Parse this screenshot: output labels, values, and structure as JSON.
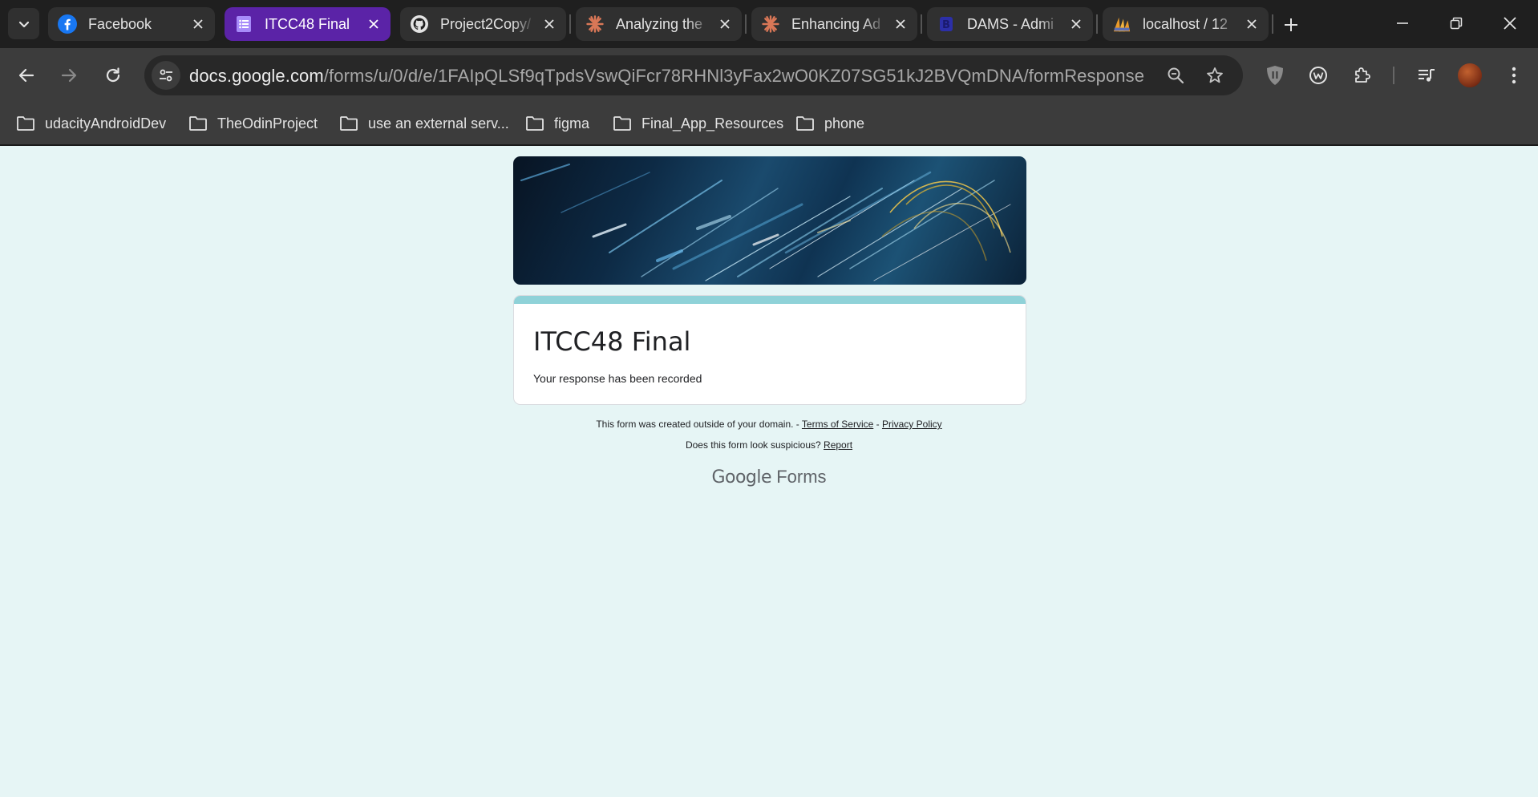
{
  "tabs": [
    {
      "title": "Facebook",
      "icon": "facebook-icon",
      "active": false
    },
    {
      "title": "ITCC48 Final",
      "icon": "google-forms-icon",
      "active": true
    },
    {
      "title": "Project2Copy/",
      "icon": "github-icon",
      "active": false
    },
    {
      "title": "Analyzing the",
      "icon": "claude-icon",
      "active": false
    },
    {
      "title": "Enhancing Ad",
      "icon": "claude-icon",
      "active": false
    },
    {
      "title": "DAMS - Admi",
      "icon": "bootstrap-icon",
      "active": false
    },
    {
      "title": "localhost / 12",
      "icon": "phpmyadmin-icon",
      "active": false
    }
  ],
  "address_bar": {
    "host": "docs.google.com",
    "path": "/forms/u/0/d/e/1FAIpQLSf9qTpdsVswQiFcr78RHNl3yFax2wO0KZ07SG51kJ2BVQmDNA/formResponse"
  },
  "bookmarks": [
    "udacityAndroidDev",
    "TheOdinProject",
    "use an external serv...",
    "figma",
    "Final_App_Resources",
    "phone"
  ],
  "form": {
    "title": "ITCC48 Final",
    "confirmation": "Your response has been recorded",
    "accent_color": "#8fd2d8"
  },
  "footer": {
    "domain_notice": "This form was created outside of your domain. -",
    "terms": "Terms of Service",
    "separator": "-",
    "privacy": "Privacy Policy",
    "suspicious": "Does this form look suspicious?",
    "report": "Report",
    "brand_google": "Google",
    "brand_forms": "Forms"
  },
  "colors": {
    "active_tab": "#5b23a7",
    "page_background": "#e6f5f5"
  }
}
